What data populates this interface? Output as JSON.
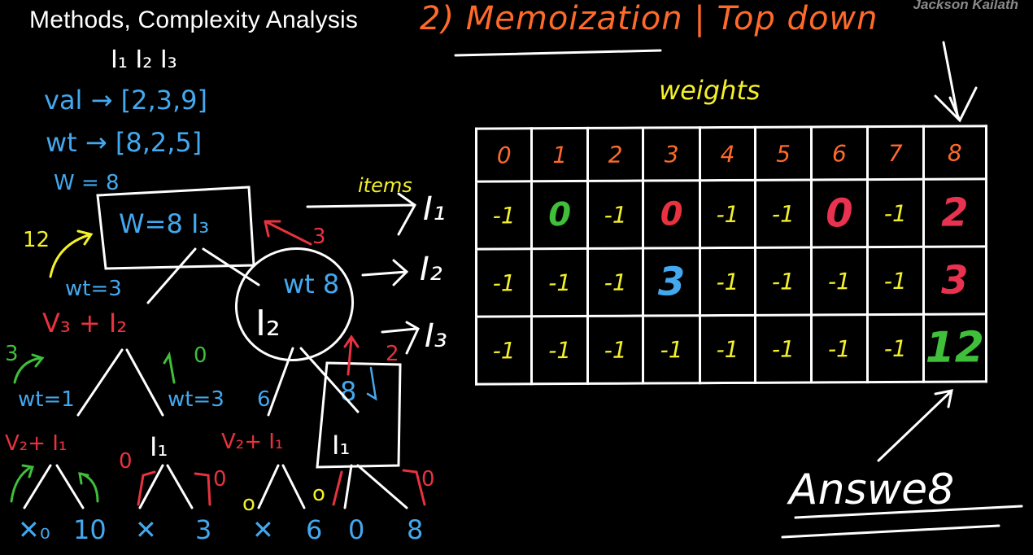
{
  "header": {
    "title": "Methods, Complexity Analysis",
    "watermark": "Jackson Kailath",
    "method": "2) Memoization | Top down"
  },
  "problem": {
    "items": "I₁ I₂ I₃",
    "val": "val → [2,3,9]",
    "wt": "wt → [8,2,5]",
    "capacity": "W = 8"
  },
  "tree": {
    "root": "W=8 I₃",
    "root_result": "12",
    "left_edge_label": "wt=3",
    "left_node": "V₃ + I₂",
    "right_node": "I₂",
    "right_box_label": "wt 8",
    "right_result": "3",
    "right_left_result": "2",
    "green_3": "3",
    "green_0": "0",
    "wt1": "wt=1",
    "wt3": "wt=3",
    "ll_node": "V₂+ I₁",
    "lr_node": "I₁",
    "rl_node": "V₂+ I₁",
    "rr_node": "I₁",
    "rr_box_label": "8",
    "rl_weight": "6",
    "leaves": [
      "✕₀",
      "10",
      "✕",
      "3",
      "✕",
      "6",
      "0",
      "8"
    ],
    "small_0a": "0",
    "small_0b": "0",
    "small_0c": "o",
    "small_0d": "o",
    "small_0e": "0"
  },
  "table": {
    "weights_label": "weights",
    "items_label": "items",
    "columns": [
      "0",
      "1",
      "2",
      "3",
      "4",
      "5",
      "6",
      "7",
      "8"
    ],
    "rows": [
      {
        "label": "I₁",
        "cells": [
          "-1",
          "0",
          "-1",
          "0",
          "-1",
          "-1",
          "0",
          "-1",
          "2"
        ]
      },
      {
        "label": "I₂",
        "cells": [
          "-1",
          "-1",
          "-1",
          "3",
          "-1",
          "-1",
          "-1",
          "-1",
          "3"
        ]
      },
      {
        "label": "I₃",
        "cells": [
          "-1",
          "-1",
          "-1",
          "-1",
          "-1",
          "-1",
          "-1",
          "-1",
          "12"
        ]
      }
    ],
    "answer_label": "Answe8"
  },
  "colors": {
    "background": "#000000",
    "white": "#ffffff",
    "orange": "#ff6a2a",
    "yellow": "#f3f02a",
    "blue": "#43a8ee",
    "red": "#e8323f",
    "green": "#3fbf3a"
  }
}
